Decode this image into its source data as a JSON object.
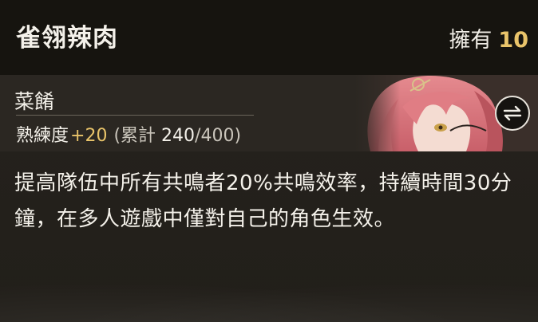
{
  "item": {
    "name": "雀翎辣肉",
    "owned_label": "擁有",
    "owned_count": "10"
  },
  "character": {
    "name": "菜餚",
    "proficiency_label": "熟練度",
    "proficiency_gain": "+20",
    "total_open": "(累計",
    "total_current": "240",
    "total_max": "/400)"
  },
  "swap_icon": "swap-arrows-icon",
  "description": "提高隊伍中所有共鳴者20%共鳴效率，持續時間30分鐘，在多人遊戲中僅對自己的角色生效。",
  "colors": {
    "accent": "#e9c46a",
    "header_bg": "#16140f",
    "panel_bg": "#24211c"
  }
}
